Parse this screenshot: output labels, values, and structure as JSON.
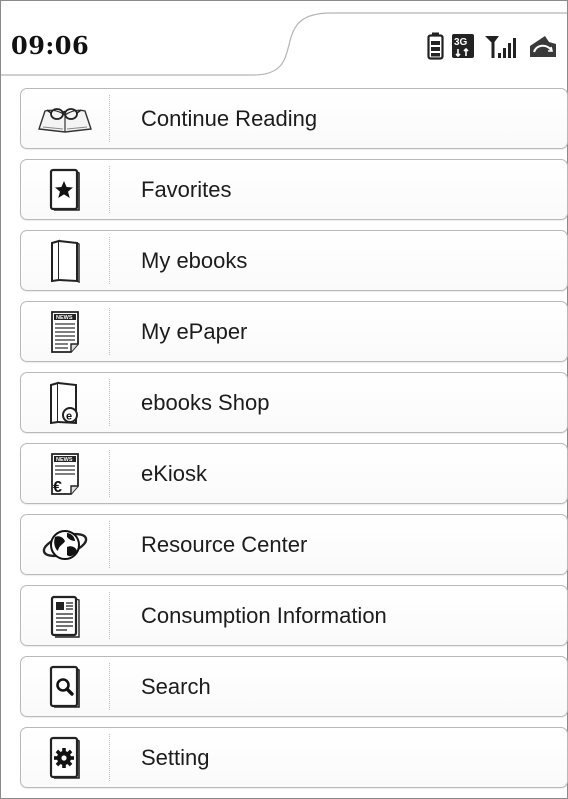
{
  "status_bar": {
    "time": "09:06",
    "network_label": "3G",
    "icons": [
      "battery-icon",
      "3g-network-icon",
      "signal-strength-icon",
      "cloud-sync-icon"
    ]
  },
  "menu": {
    "items": [
      {
        "label": "Continue Reading",
        "icon": "open-book-glasses-icon"
      },
      {
        "label": "Favorites",
        "icon": "star-book-icon"
      },
      {
        "label": "My ebooks",
        "icon": "book-icon"
      },
      {
        "label": "My ePaper",
        "icon": "newspaper-icon"
      },
      {
        "label": "ebooks Shop",
        "icon": "book-shop-icon"
      },
      {
        "label": "eKiosk",
        "icon": "news-euro-icon"
      },
      {
        "label": "Resource Center",
        "icon": "globe-icon"
      },
      {
        "label": "Consumption Information",
        "icon": "document-info-icon"
      },
      {
        "label": "Search",
        "icon": "search-book-icon"
      },
      {
        "label": "Setting",
        "icon": "gear-book-icon"
      }
    ]
  },
  "colors": {
    "border": "#b9b9b9",
    "text": "#1c1c1c",
    "icon_stroke": "#222222"
  }
}
